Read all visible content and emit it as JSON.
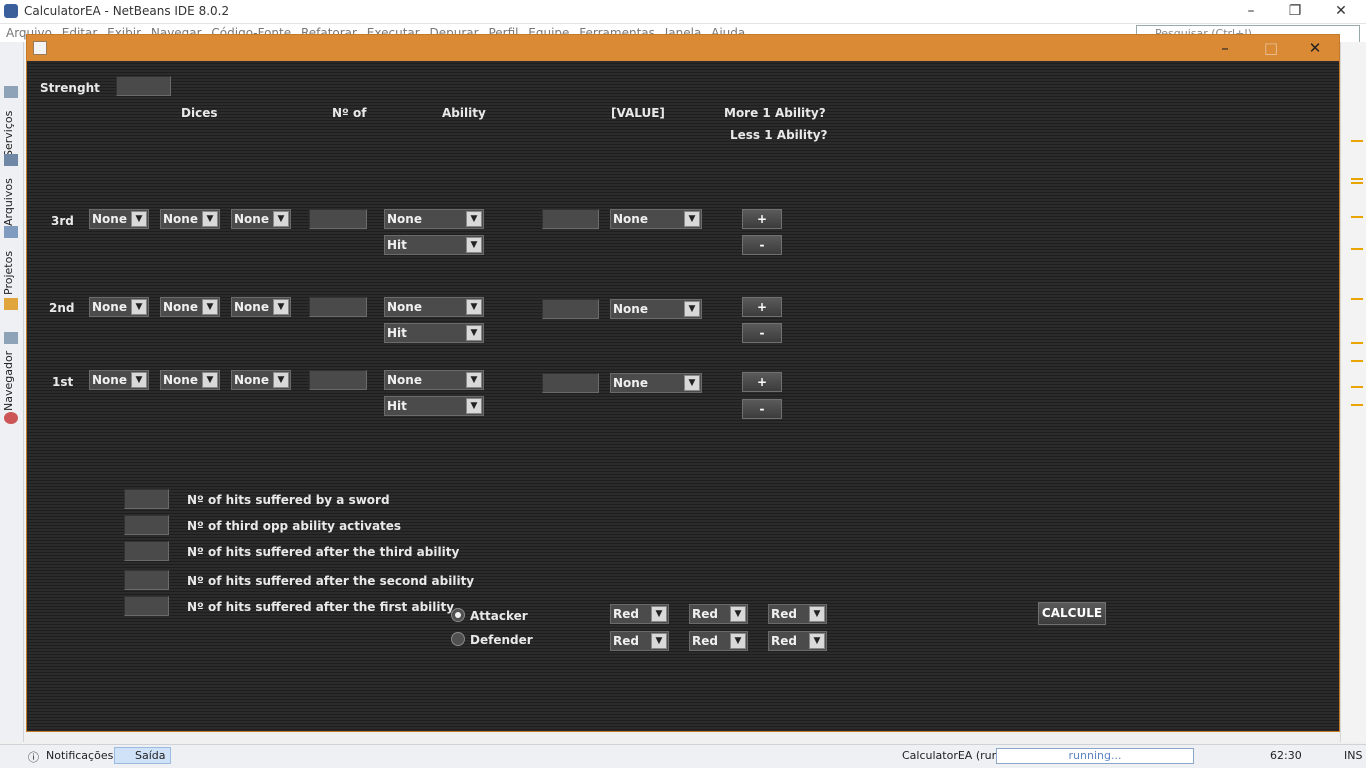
{
  "ide": {
    "title": "CalculatorEA - NetBeans IDE 8.0.2",
    "menu": [
      "Arquivo",
      "Editar",
      "Exibir",
      "Navegar",
      "Código-Fonte",
      "Refatorar",
      "Executar",
      "Depurar",
      "Perfil",
      "Equipe",
      "Ferramentas",
      "Janela",
      "Ajuda"
    ],
    "search_placeholder": "Pesquisar (Ctrl+I)",
    "side_tabs": [
      "Serviços",
      "Arquivos",
      "Projetos",
      "Navegador"
    ],
    "status": {
      "notifications": "Notificações",
      "output": "Saída",
      "run_label": "CalculatorEA (run)",
      "progress_text": "running...",
      "position": "62:30",
      "mode": "INS"
    }
  },
  "form": {
    "strength_label": "Strenght",
    "headers": {
      "dices": "Dices",
      "n_of": "Nº of",
      "ability": "Ability",
      "value": "[VALUE]",
      "more": "More 1 Ability?",
      "less": "Less 1 Ability?"
    },
    "rows": [
      {
        "label": "3rd",
        "dice": [
          "None",
          "None",
          "None"
        ],
        "ability": "None",
        "ability2": "Hit",
        "value_select": "None",
        "plus": "+",
        "minus": "-"
      },
      {
        "label": "2nd",
        "dice": [
          "None",
          "None",
          "None"
        ],
        "ability": "None",
        "ability2": "Hit",
        "value_select": "None",
        "plus": "+",
        "minus": "-"
      },
      {
        "label": "1st",
        "dice": [
          "None",
          "None",
          "None"
        ],
        "ability": "None",
        "ability2": "Hit",
        "value_select": "None",
        "plus": "+",
        "minus": "-"
      }
    ],
    "results": [
      "Nº of hits suffered by a sword",
      "Nº of third opp ability activates",
      "Nº of hits suffered after the third ability",
      "Nº of hits suffered after the second ability",
      "Nº of hits suffered after the first ability"
    ],
    "roles": {
      "attacker": "Attacker",
      "defender": "Defender",
      "selected": "Attacker"
    },
    "colors_row1": [
      "Red",
      "Red",
      "Red"
    ],
    "colors_row2": [
      "Red",
      "Red",
      "Red"
    ],
    "calc_button": "CALCULE"
  },
  "theme": {
    "accent": "#da8a34",
    "background": "#2b2b2b"
  }
}
